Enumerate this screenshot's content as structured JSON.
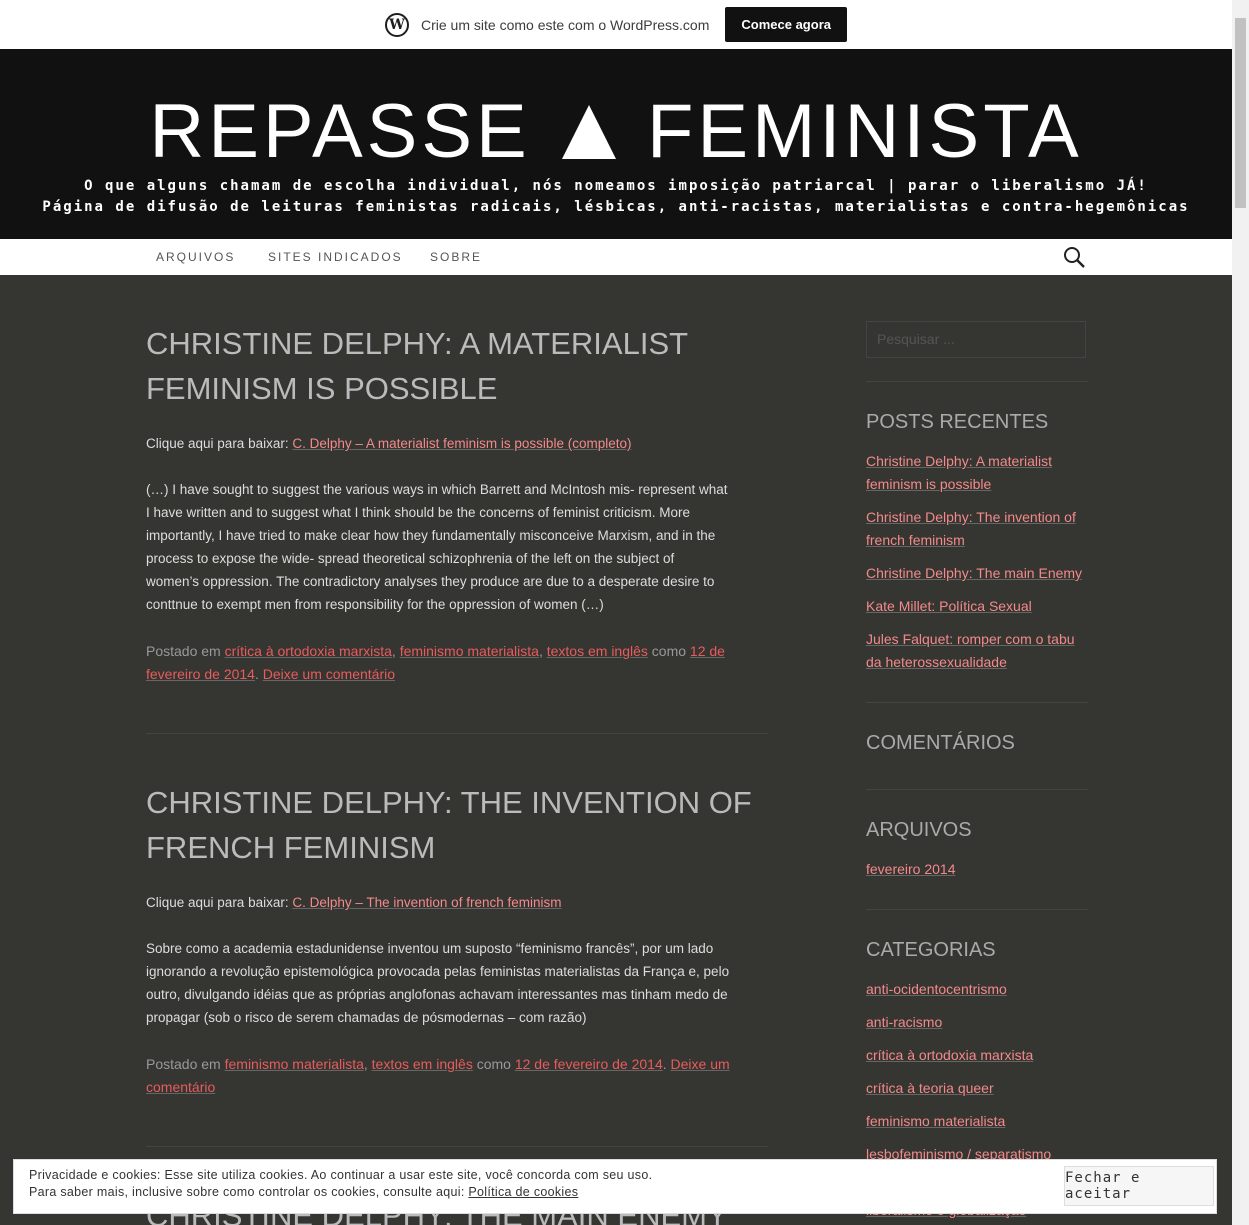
{
  "wpbar": {
    "text": "Crie um site como este com o WordPress.com",
    "button": "Comece agora"
  },
  "header": {
    "title_left": "REPASSE",
    "title_right": "FEMINISTA",
    "desc_line1": "O que alguns chamam de escolha individual, nós nomeamos imposição patriarcal  | parar o liberalismo JÁ!",
    "desc_line2": "Página de difusão de leituras feministas radicais, lésbicas, anti-racistas, materialistas e contra-hegemônicas"
  },
  "nav": {
    "items": [
      "ARQUIVOS",
      "SITES INDICADOS",
      "SOBRE"
    ]
  },
  "posts": [
    {
      "title_l1": "CHRISTINE DELPHY: A MATERIALIST",
      "title_l2": "FEMINISM IS POSSIBLE",
      "download_label": "Clique aqui para baixar: ",
      "download_link": "C. Delphy – A materialist feminism is possible (completo)",
      "body": [
        "(…) I have sought to suggest the various ways in which Barrett and McIntosh mis- represent what",
        "I have written and to suggest what I think should be the concerns of feminist criticism. More",
        "importantly, I have tried to make clear how they fundamentally misconceive Marxism, and in the",
        "process to expose the wide- spread theoretical schizophrenia of the left on the subject of",
        "women’s oppression. The contradictory analyses they produce are due to a desperate desire to",
        "conttnue to exempt men from responsibility for the oppression of women (…)"
      ],
      "posted": "Postado em ",
      "cats": [
        "crítica à ortodoxia marxista",
        "feminismo materialista",
        "textos em inglês"
      ],
      "como": " como ",
      "date_l1": "12 de",
      "date_l2": "fevereiro de 2014",
      "comment": "Deixe um comentário"
    },
    {
      "title_l1": "CHRISTINE DELPHY: THE INVENTION OF",
      "title_l2": "FRENCH FEMINISM",
      "download_label": "Clique aqui para baixar: ",
      "download_link": "C. Delphy – The invention of french feminism",
      "body": [
        "Sobre como a academia estadunidense inventou um suposto “feminismo francês”, por um lado",
        "ignorando a revolução epistemológica provocada pelas feministas materialistas da França e, pelo",
        "outro, divulgando idéias que as próprias anglofonas achavam interessantes mas tinham medo de",
        "propagar (sob o risco de serem chamadas de pósmodernas – com razão)"
      ],
      "posted": "Postado em ",
      "cats": [
        "feminismo materialista",
        "textos em inglês"
      ],
      "como": " como ",
      "date": "12 de fevereiro de 2014",
      "comment_l1": "Deixe um",
      "comment_l2": "comentário"
    },
    {
      "title_l1": "CHRISTINE DELPHY: THE MAIN ENEMY"
    }
  ],
  "sidebar": {
    "search_placeholder": "Pesquisar ...",
    "recent_heading": "POSTS RECENTES",
    "recent": [
      [
        "Christine Delphy: A materialist",
        "feminism is possible"
      ],
      [
        "Christine Delphy: The invention of",
        "french feminism"
      ],
      [
        "Christine Delphy: The main Enemy"
      ],
      [
        "Kate Millet: Política Sexual"
      ],
      [
        "Jules Falquet: romper com o tabu",
        "da heterossexualidade"
      ]
    ],
    "comments_heading": "COMENTÁRIOS",
    "archives_heading": "ARQUIVOS",
    "archives": [
      "fevereiro 2014"
    ],
    "categories_heading": "CATEGORIAS",
    "categories": [
      "anti-ocidentocentrismo",
      "anti-racismo",
      "crítica à ortodoxia marxista",
      "crítica à teoria queer",
      "feminismo materialista",
      "lesbofeminismo / separatismo",
      "liberalismo e globalização"
    ]
  },
  "cookie": {
    "line1": "Privacidade e cookies: Esse site utiliza cookies. Ao continuar a usar este site, você concorda com seu uso.",
    "line2_prefix": "Para saber mais, inclusive sobre como controlar os cookies, consulte aqui: ",
    "line2_link": "Política de cookies",
    "button": "Fechar e aceitar"
  }
}
